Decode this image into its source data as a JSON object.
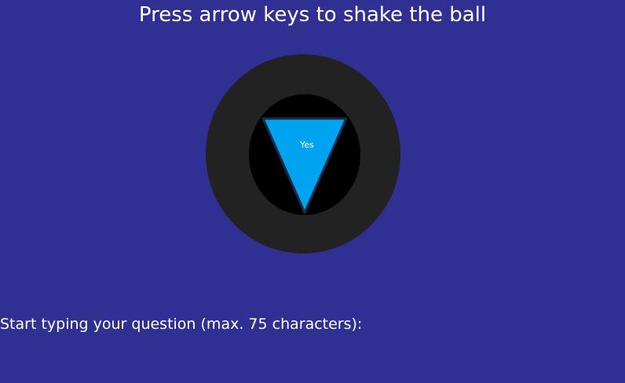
{
  "instruction": "Press arrow keys to shake the ball",
  "ball": {
    "answer": "Yes",
    "colors": {
      "background": "#303092",
      "ball_outer": "#222222",
      "ball_window": "#000000",
      "triangle": "#00a3f0",
      "triangle_edge": "#1c2a4a",
      "text": "#ffffff"
    }
  },
  "prompt": "Start typing your question (max. 75 characters):",
  "question": {
    "value": ""
  }
}
